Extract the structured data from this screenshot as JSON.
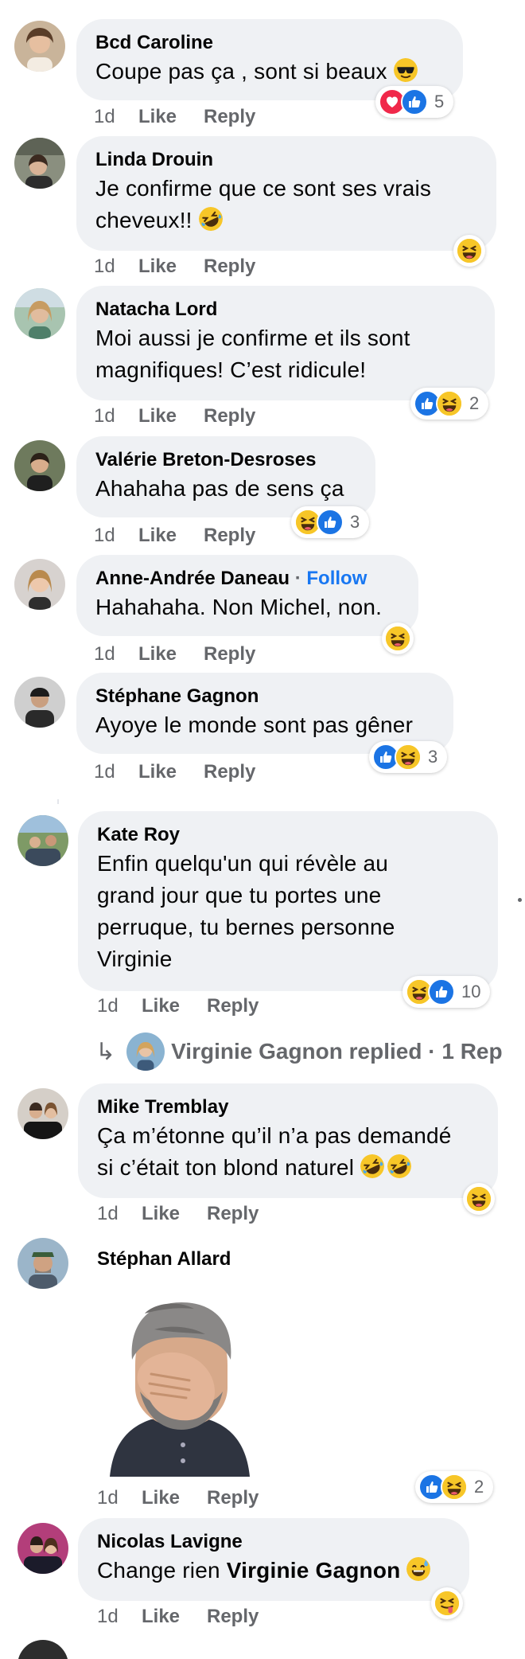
{
  "comments": [
    {
      "author": "Bcd Caroline",
      "text": "Coupe pas ça , sont si beaux",
      "ago": "1d",
      "like": "Like",
      "reply": "Reply",
      "reaction_count": "5"
    },
    {
      "author": "Linda Drouin",
      "line1": "Je confirme que ce sont ses vrais",
      "line2": "cheveux!!",
      "ago": "1d",
      "like": "Like",
      "reply": "Reply"
    },
    {
      "author": "Natacha Lord",
      "line1": "Moi aussi je confirme et ils sont",
      "line2": "magnifiques! C’est ridicule!",
      "ago": "1d",
      "like": "Like",
      "reply": "Reply",
      "reaction_count": "2"
    },
    {
      "author": "Valérie Breton-Desroses",
      "text": "Ahahaha pas de sens ça",
      "ago": "1d",
      "like": "Like",
      "reply": "Reply",
      "reaction_count": "3"
    },
    {
      "author": "Anne-Andrée Daneau",
      "follow_sep": "·",
      "follow": "Follow",
      "text": "Hahahaha. Non Michel, non.",
      "ago": "1d",
      "like": "Like",
      "reply": "Reply"
    },
    {
      "author": "Stéphane Gagnon",
      "text": "Ayoye le monde sont pas gêner",
      "ago": "1d",
      "like": "Like",
      "reply": "Reply",
      "reaction_count": "3"
    },
    {
      "author": "Kate Roy",
      "line1": "Enfin quelqu'un qui révèle au",
      "line2": "grand jour que tu portes une",
      "line3": "perruque, tu bernes personne",
      "line4": "Virginie",
      "ago": "1d",
      "like": "Like",
      "reply": "Reply",
      "reaction_count": "10"
    },
    {
      "author": "Mike Tremblay",
      "line1": "Ça m’étonne qu’il n’a pas demandé",
      "line2": "si c’était ton blond naturel",
      "ago": "1d",
      "like": "Like",
      "reply": "Reply"
    },
    {
      "author": "Stéphan Allard",
      "ago": "1d",
      "like": "Like",
      "reply": "Reply",
      "reaction_count": "2"
    },
    {
      "author": "Nicolas Lavigne",
      "text_prefix": "Change rien ",
      "mention": "Virginie Gagnon",
      "ago": "1d",
      "like": "Like",
      "reply": "Reply"
    }
  ],
  "replied": {
    "text": "Virginie Gagnon replied · 1 Rep"
  },
  "icons": {
    "love": "heart-icon",
    "like": "thumbs-up-icon",
    "haha": "laughing-face-icon",
    "cool": "sunglasses-emoji",
    "rofl": "rolling-laughing-emoji",
    "sweat": "sweat-smile-emoji",
    "tongue": "winking-tongue-emoji",
    "reply_arrow": "reply-arrow-icon"
  },
  "colors": {
    "bubble": "#eff1f4",
    "meta": "#65676b",
    "link": "#1877f2",
    "like": "#1b74e4",
    "love": "#f0284a",
    "haha": "#f7c628"
  }
}
